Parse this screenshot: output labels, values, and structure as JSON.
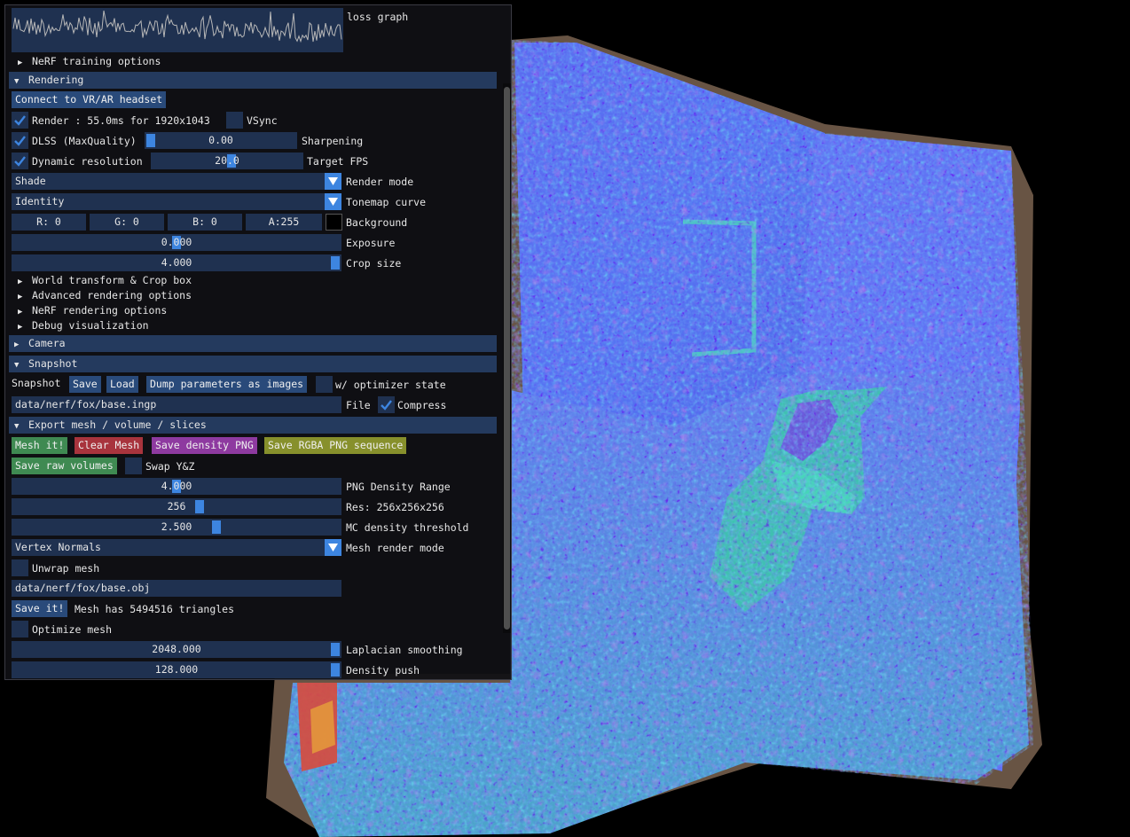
{
  "viewport": {
    "scene": "mesh-normals-render"
  },
  "panel": {
    "loss_graph_label": "loss graph",
    "nerf_training_options": "NeRF training options",
    "rendering": {
      "header": "Rendering",
      "vr_button": "Connect to VR/AR headset",
      "render_label": "Render : 55.0ms for 1920x1043",
      "render_checked": true,
      "vsync_label": "VSync",
      "vsync_checked": false,
      "dlss_label": "DLSS (MaxQuality)",
      "dlss_checked": true,
      "sharpening_value": "0.00",
      "sharpening_label": "Sharpening",
      "dynres_label": "Dynamic resolution",
      "dynres_checked": true,
      "target_fps_value": "20.0",
      "target_fps_label": "Target FPS",
      "render_mode_value": "Shade",
      "render_mode_label": "Render mode",
      "tonemap_value": "Identity",
      "tonemap_label": "Tonemap curve",
      "bg_r": "R:  0",
      "bg_g": "G:  0",
      "bg_b": "B:  0",
      "bg_a": "A:255",
      "background_label": "Background",
      "background_color": "#000000",
      "exposure_value": "0.000",
      "exposure_label": "Exposure",
      "crop_value": "4.000",
      "crop_label": "Crop size",
      "world_transform": "World transform & Crop box",
      "advanced_rendering": "Advanced rendering options",
      "nerf_rendering": "NeRF rendering options",
      "debug_visualization": "Debug visualization"
    },
    "camera": {
      "header": "Camera"
    },
    "snapshot": {
      "header": "Snapshot",
      "label": "Snapshot",
      "save": "Save",
      "load": "Load",
      "dump": "Dump parameters as images",
      "optimizer_label": "w/ optimizer state",
      "optimizer_checked": false,
      "file_value": "data/nerf/fox/base.ingp",
      "file_label": "File",
      "compress_label": "Compress",
      "compress_checked": true
    },
    "export": {
      "header": "Export mesh / volume / slices",
      "mesh_it": "Mesh it!",
      "clear_mesh": "Clear Mesh",
      "save_density_png": "Save density PNG",
      "save_rgba_png": "Save RGBA PNG sequence",
      "save_raw_volumes": "Save raw volumes",
      "swap_label": "Swap Y&Z",
      "swap_checked": false,
      "png_density_value": "4.000",
      "png_density_label": "PNG Density Range",
      "res_value": "256",
      "res_label": "Res: 256x256x256",
      "mc_value": "2.500",
      "mc_label": "MC density threshold",
      "mesh_render_mode_value": "Vertex Normals",
      "mesh_render_mode_label": "Mesh render mode",
      "unwrap_label": "Unwrap mesh",
      "unwrap_checked": false,
      "obj_path": "data/nerf/fox/base.obj",
      "save_it": "Save it!",
      "mesh_info": "Mesh has 5494516 triangles",
      "optimize_label": "Optimize mesh",
      "optimize_checked": false,
      "laplacian_value": "2048.000",
      "laplacian_label": "Laplacian smoothing",
      "density_push_value": "128.000",
      "density_push_label": "Density push"
    }
  },
  "colors": {
    "frame_bg": "#1f3150",
    "button": "#294a7a",
    "header": "#243a5e",
    "accent": "#3d85e0",
    "green_button": "#3f8a52",
    "red_button": "#a8343d",
    "purple_button": "#8e3aa0",
    "olive_button": "#87902c"
  }
}
